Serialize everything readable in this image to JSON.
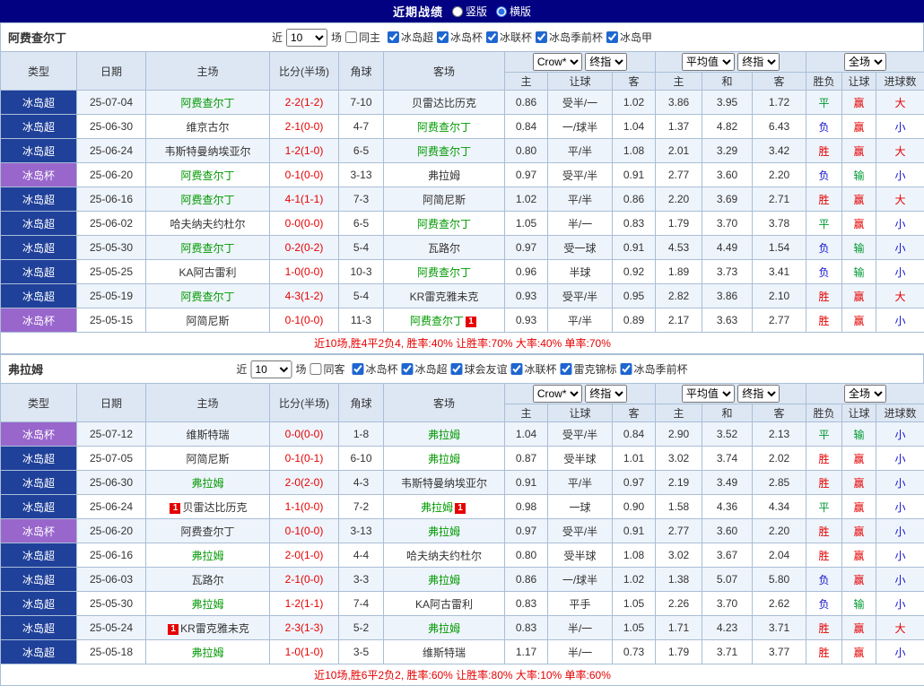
{
  "colors": {
    "topbar_bg": "#010182",
    "league_super_bg": "#20419a",
    "league_cup_bg": "#9966cc",
    "header_bg": "#dde7f4",
    "row_alt_bg": "#eef4fb",
    "focus_team": "#009900",
    "result_red": "#e60000",
    "result_green": "#009933",
    "result_blue": "#1212cc"
  },
  "topbar": {
    "title": "近期战绩",
    "vertical_label": "竖版",
    "horizontal_label": "横版"
  },
  "table_headers": {
    "type": "类型",
    "date": "日期",
    "home": "主场",
    "score": "比分(半场)",
    "corner": "角球",
    "away": "客场",
    "odds_home": "主",
    "odds_handicap": "让球",
    "odds_away": "客",
    "avg_home": "主",
    "avg_draw": "和",
    "avg_away": "客",
    "result_wdl": "胜负",
    "result_handicap": "让球",
    "result_goals": "进球数"
  },
  "sections": [
    {
      "team": "阿费查尔丁",
      "near_label": "近",
      "count": "10",
      "games_label": "场",
      "same_label": "同主",
      "leagues": [
        "冰岛超",
        "冰岛杯",
        "冰联杯",
        "冰岛季前杯",
        "冰岛甲"
      ],
      "dropdowns": {
        "company": "Crow*",
        "company_mode": "终指",
        "avg": "平均值",
        "avg_mode": "终指",
        "scope": "全场"
      },
      "summary": "近10场,胜4平2负4, 胜率:40% 让胜率:70% 大率:40% 单率:70%",
      "rows": [
        {
          "league": "冰岛超",
          "league_class": "super",
          "date": "25-07-04",
          "home": "阿费查尔丁",
          "home_focus": true,
          "score": "2-2(1-2)",
          "corner": "7-10",
          "away": "贝雷达比历克",
          "away_focus": false,
          "o1": "0.86",
          "handicap": "受半/一",
          "o2": "1.02",
          "a1": "3.86",
          "a2": "3.95",
          "a3": "1.72",
          "r1": "平",
          "r1c": "green",
          "r2": "赢",
          "r2c": "red",
          "r3": "大",
          "r3c": "red"
        },
        {
          "league": "冰岛超",
          "league_class": "super",
          "date": "25-06-30",
          "home": "维京古尔",
          "home_focus": false,
          "score": "2-1(0-0)",
          "corner": "4-7",
          "away": "阿费查尔丁",
          "away_focus": true,
          "o1": "0.84",
          "handicap": "一/球半",
          "o2": "1.04",
          "a1": "1.37",
          "a2": "4.82",
          "a3": "6.43",
          "r1": "负",
          "r1c": "blue",
          "r2": "赢",
          "r2c": "red",
          "r3": "小",
          "r3c": "blue"
        },
        {
          "league": "冰岛超",
          "league_class": "super",
          "date": "25-06-24",
          "home": "韦斯特曼纳埃亚尔",
          "home_focus": false,
          "score": "1-2(1-0)",
          "corner": "6-5",
          "away": "阿费查尔丁",
          "away_focus": true,
          "o1": "0.80",
          "handicap": "平/半",
          "o2": "1.08",
          "a1": "2.01",
          "a2": "3.29",
          "a3": "3.42",
          "r1": "胜",
          "r1c": "red",
          "r2": "赢",
          "r2c": "red",
          "r3": "大",
          "r3c": "red"
        },
        {
          "league": "冰岛杯",
          "league_class": "cup",
          "date": "25-06-20",
          "home": "阿费查尔丁",
          "home_focus": true,
          "score": "0-1(0-0)",
          "corner": "3-13",
          "away": "弗拉姆",
          "away_focus": false,
          "o1": "0.97",
          "handicap": "受平/半",
          "o2": "0.91",
          "a1": "2.77",
          "a2": "3.60",
          "a3": "2.20",
          "r1": "负",
          "r1c": "blue",
          "r2": "输",
          "r2c": "green",
          "r3": "小",
          "r3c": "blue"
        },
        {
          "league": "冰岛超",
          "league_class": "super",
          "date": "25-06-16",
          "home": "阿费查尔丁",
          "home_focus": true,
          "score": "4-1(1-1)",
          "corner": "7-3",
          "away": "阿简尼斯",
          "away_focus": false,
          "o1": "1.02",
          "handicap": "平/半",
          "o2": "0.86",
          "a1": "2.20",
          "a2": "3.69",
          "a3": "2.71",
          "r1": "胜",
          "r1c": "red",
          "r2": "赢",
          "r2c": "red",
          "r3": "大",
          "r3c": "red"
        },
        {
          "league": "冰岛超",
          "league_class": "super",
          "date": "25-06-02",
          "home": "哈夫纳夫约杜尔",
          "home_focus": false,
          "score": "0-0(0-0)",
          "corner": "6-5",
          "away": "阿费查尔丁",
          "away_focus": true,
          "o1": "1.05",
          "handicap": "半/一",
          "o2": "0.83",
          "a1": "1.79",
          "a2": "3.70",
          "a3": "3.78",
          "r1": "平",
          "r1c": "green",
          "r2": "赢",
          "r2c": "red",
          "r3": "小",
          "r3c": "blue"
        },
        {
          "league": "冰岛超",
          "league_class": "super",
          "date": "25-05-30",
          "home": "阿费查尔丁",
          "home_focus": true,
          "score": "0-2(0-2)",
          "corner": "5-4",
          "away": "瓦路尔",
          "away_focus": false,
          "o1": "0.97",
          "handicap": "受一球",
          "o2": "0.91",
          "a1": "4.53",
          "a2": "4.49",
          "a3": "1.54",
          "r1": "负",
          "r1c": "blue",
          "r2": "输",
          "r2c": "green",
          "r3": "小",
          "r3c": "blue"
        },
        {
          "league": "冰岛超",
          "league_class": "super",
          "date": "25-05-25",
          "home": "KA阿古雷利",
          "home_focus": false,
          "score": "1-0(0-0)",
          "corner": "10-3",
          "away": "阿费查尔丁",
          "away_focus": true,
          "o1": "0.96",
          "handicap": "半球",
          "o2": "0.92",
          "a1": "1.89",
          "a2": "3.73",
          "a3": "3.41",
          "r1": "负",
          "r1c": "blue",
          "r2": "输",
          "r2c": "green",
          "r3": "小",
          "r3c": "blue"
        },
        {
          "league": "冰岛超",
          "league_class": "super",
          "date": "25-05-19",
          "home": "阿费查尔丁",
          "home_focus": true,
          "score": "4-3(1-2)",
          "corner": "5-4",
          "away": "KR雷克雅未克",
          "away_focus": false,
          "o1": "0.93",
          "handicap": "受平/半",
          "o2": "0.95",
          "a1": "2.82",
          "a2": "3.86",
          "a3": "2.10",
          "r1": "胜",
          "r1c": "red",
          "r2": "赢",
          "r2c": "red",
          "r3": "大",
          "r3c": "red"
        },
        {
          "league": "冰岛杯",
          "league_class": "cup",
          "date": "25-05-15",
          "home": "阿简尼斯",
          "home_focus": false,
          "score": "0-1(0-0)",
          "corner": "11-3",
          "away": "阿费查尔丁",
          "away_focus": true,
          "away_badge": "1",
          "o1": "0.93",
          "handicap": "平/半",
          "o2": "0.89",
          "a1": "2.17",
          "a2": "3.63",
          "a3": "2.77",
          "r1": "胜",
          "r1c": "red",
          "r2": "赢",
          "r2c": "red",
          "r3": "小",
          "r3c": "blue"
        }
      ]
    },
    {
      "team": "弗拉姆",
      "near_label": "近",
      "count": "10",
      "games_label": "场",
      "same_label": "同客",
      "leagues": [
        "冰岛杯",
        "冰岛超",
        "球会友谊",
        "冰联杯",
        "雷克锦标",
        "冰岛季前杯"
      ],
      "dropdowns": {
        "company": "Crow*",
        "company_mode": "终指",
        "avg": "平均值",
        "avg_mode": "终指",
        "scope": "全场"
      },
      "summary": "近10场,胜6平2负2, 胜率:60% 让胜率:80% 大率:10% 单率:60%",
      "rows": [
        {
          "league": "冰岛杯",
          "league_class": "cup",
          "date": "25-07-12",
          "home": "维斯特瑞",
          "home_focus": false,
          "score": "0-0(0-0)",
          "corner": "1-8",
          "away": "弗拉姆",
          "away_focus": true,
          "o1": "1.04",
          "handicap": "受平/半",
          "o2": "0.84",
          "a1": "2.90",
          "a2": "3.52",
          "a3": "2.13",
          "r1": "平",
          "r1c": "green",
          "r2": "输",
          "r2c": "green",
          "r3": "小",
          "r3c": "blue"
        },
        {
          "league": "冰岛超",
          "league_class": "super",
          "date": "25-07-05",
          "home": "阿简尼斯",
          "home_focus": false,
          "score": "0-1(0-1)",
          "corner": "6-10",
          "away": "弗拉姆",
          "away_focus": true,
          "o1": "0.87",
          "handicap": "受半球",
          "o2": "1.01",
          "a1": "3.02",
          "a2": "3.74",
          "a3": "2.02",
          "r1": "胜",
          "r1c": "red",
          "r2": "赢",
          "r2c": "red",
          "r3": "小",
          "r3c": "blue"
        },
        {
          "league": "冰岛超",
          "league_class": "super",
          "date": "25-06-30",
          "home": "弗拉姆",
          "home_focus": true,
          "score": "2-0(2-0)",
          "corner": "4-3",
          "away": "韦斯特曼纳埃亚尔",
          "away_focus": false,
          "o1": "0.91",
          "handicap": "平/半",
          "o2": "0.97",
          "a1": "2.19",
          "a2": "3.49",
          "a3": "2.85",
          "r1": "胜",
          "r1c": "red",
          "r2": "赢",
          "r2c": "red",
          "r3": "小",
          "r3c": "blue"
        },
        {
          "league": "冰岛超",
          "league_class": "super",
          "date": "25-06-24",
          "home": "贝雷达比历克",
          "home_focus": false,
          "home_badge": "1",
          "score": "1-1(0-0)",
          "corner": "7-2",
          "away": "弗拉姆",
          "away_focus": true,
          "away_badge": "1",
          "o1": "0.98",
          "handicap": "一球",
          "o2": "0.90",
          "a1": "1.58",
          "a2": "4.36",
          "a3": "4.34",
          "r1": "平",
          "r1c": "green",
          "r2": "赢",
          "r2c": "red",
          "r3": "小",
          "r3c": "blue"
        },
        {
          "league": "冰岛杯",
          "league_class": "cup",
          "date": "25-06-20",
          "home": "阿费查尔丁",
          "home_focus": false,
          "score": "0-1(0-0)",
          "corner": "3-13",
          "away": "弗拉姆",
          "away_focus": true,
          "o1": "0.97",
          "handicap": "受平/半",
          "o2": "0.91",
          "a1": "2.77",
          "a2": "3.60",
          "a3": "2.20",
          "r1": "胜",
          "r1c": "red",
          "r2": "赢",
          "r2c": "red",
          "r3": "小",
          "r3c": "blue"
        },
        {
          "league": "冰岛超",
          "league_class": "super",
          "date": "25-06-16",
          "home": "弗拉姆",
          "home_focus": true,
          "score": "2-0(1-0)",
          "corner": "4-4",
          "away": "哈夫纳夫约杜尔",
          "away_focus": false,
          "o1": "0.80",
          "handicap": "受半球",
          "o2": "1.08",
          "a1": "3.02",
          "a2": "3.67",
          "a3": "2.04",
          "r1": "胜",
          "r1c": "red",
          "r2": "赢",
          "r2c": "red",
          "r3": "小",
          "r3c": "blue"
        },
        {
          "league": "冰岛超",
          "league_class": "super",
          "date": "25-06-03",
          "home": "瓦路尔",
          "home_focus": false,
          "score": "2-1(0-0)",
          "corner": "3-3",
          "away": "弗拉姆",
          "away_focus": true,
          "o1": "0.86",
          "handicap": "一/球半",
          "o2": "1.02",
          "a1": "1.38",
          "a2": "5.07",
          "a3": "5.80",
          "r1": "负",
          "r1c": "blue",
          "r2": "赢",
          "r2c": "red",
          "r3": "小",
          "r3c": "blue"
        },
        {
          "league": "冰岛超",
          "league_class": "super",
          "date": "25-05-30",
          "home": "弗拉姆",
          "home_focus": true,
          "score": "1-2(1-1)",
          "corner": "7-4",
          "away": "KA阿古雷利",
          "away_focus": false,
          "o1": "0.83",
          "handicap": "平手",
          "o2": "1.05",
          "a1": "2.26",
          "a2": "3.70",
          "a3": "2.62",
          "r1": "负",
          "r1c": "blue",
          "r2": "输",
          "r2c": "green",
          "r3": "小",
          "r3c": "blue"
        },
        {
          "league": "冰岛超",
          "league_class": "super",
          "date": "25-05-24",
          "home": "KR雷克雅未克",
          "home_focus": false,
          "home_badge": "1",
          "score": "2-3(1-3)",
          "corner": "5-2",
          "away": "弗拉姆",
          "away_focus": true,
          "o1": "0.83",
          "handicap": "半/一",
          "o2": "1.05",
          "a1": "1.71",
          "a2": "4.23",
          "a3": "3.71",
          "r1": "胜",
          "r1c": "red",
          "r2": "赢",
          "r2c": "red",
          "r3": "大",
          "r3c": "red"
        },
        {
          "league": "冰岛超",
          "league_class": "super",
          "date": "25-05-18",
          "home": "弗拉姆",
          "home_focus": true,
          "score": "1-0(1-0)",
          "corner": "3-5",
          "away": "维斯特瑞",
          "away_focus": false,
          "o1": "1.17",
          "handicap": "半/一",
          "o2": "0.73",
          "a1": "1.79",
          "a2": "3.71",
          "a3": "3.77",
          "r1": "胜",
          "r1c": "red",
          "r2": "赢",
          "r2c": "red",
          "r3": "小",
          "r3c": "blue"
        }
      ]
    }
  ]
}
